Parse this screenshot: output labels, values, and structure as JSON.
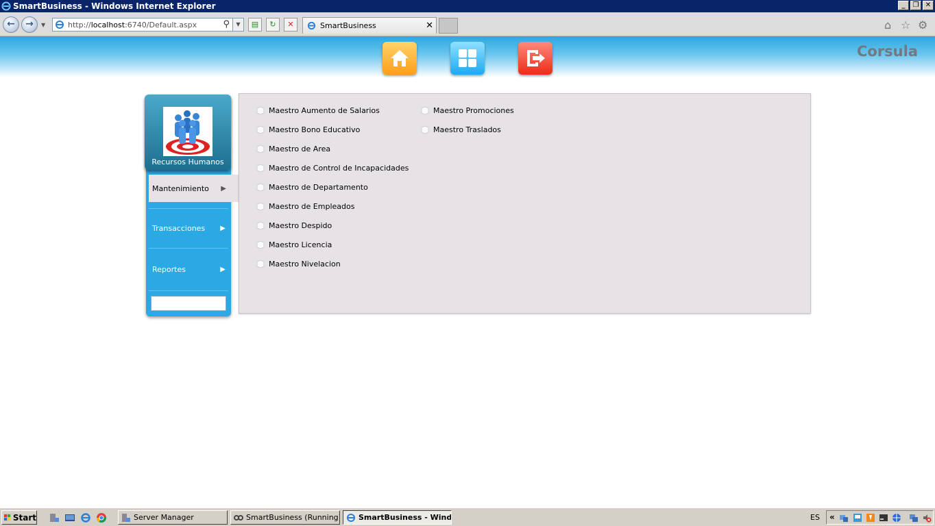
{
  "window": {
    "title": "SmartBusiness - Windows Internet Explorer",
    "minimize": "_",
    "restore": "❐",
    "close": "✕"
  },
  "browser": {
    "url_prefix": "http://",
    "url_host": "localhost",
    "url_rest": ":6740/Default.aspx",
    "tab_title": "SmartBusiness",
    "tab_close": "✕"
  },
  "app": {
    "brand": "Corsula",
    "module_label": "Recursos Humanos",
    "menu": [
      {
        "label": "Mantenimiento",
        "arrow": "▶"
      },
      {
        "label": "Transacciones",
        "arrow": "▶"
      },
      {
        "label": "Reportes",
        "arrow": "▶"
      }
    ],
    "links_col1": [
      "Maestro Aumento de Salarios",
      "Maestro Bono Educativo",
      "Maestro de Area",
      "Maestro de Control de Incapacidades",
      "Maestro de Departamento",
      "Maestro de Empleados",
      "Maestro Despido",
      "Maestro Licencia",
      "Maestro Nivelacion"
    ],
    "links_col2": [
      "Maestro Promociones",
      "Maestro Traslados"
    ]
  },
  "taskbar": {
    "start": "Start",
    "items": [
      "Server Manager",
      "SmartBusiness (Running)...",
      "SmartBusiness - Wind..."
    ],
    "language": "ES",
    "tray_chevron": "«"
  },
  "colors": {
    "header_blue": "#2aa8e0",
    "panel_blue": "#2aa9e4",
    "content_bg": "#e6e2e6",
    "brand_gray": "#6f7a82"
  }
}
